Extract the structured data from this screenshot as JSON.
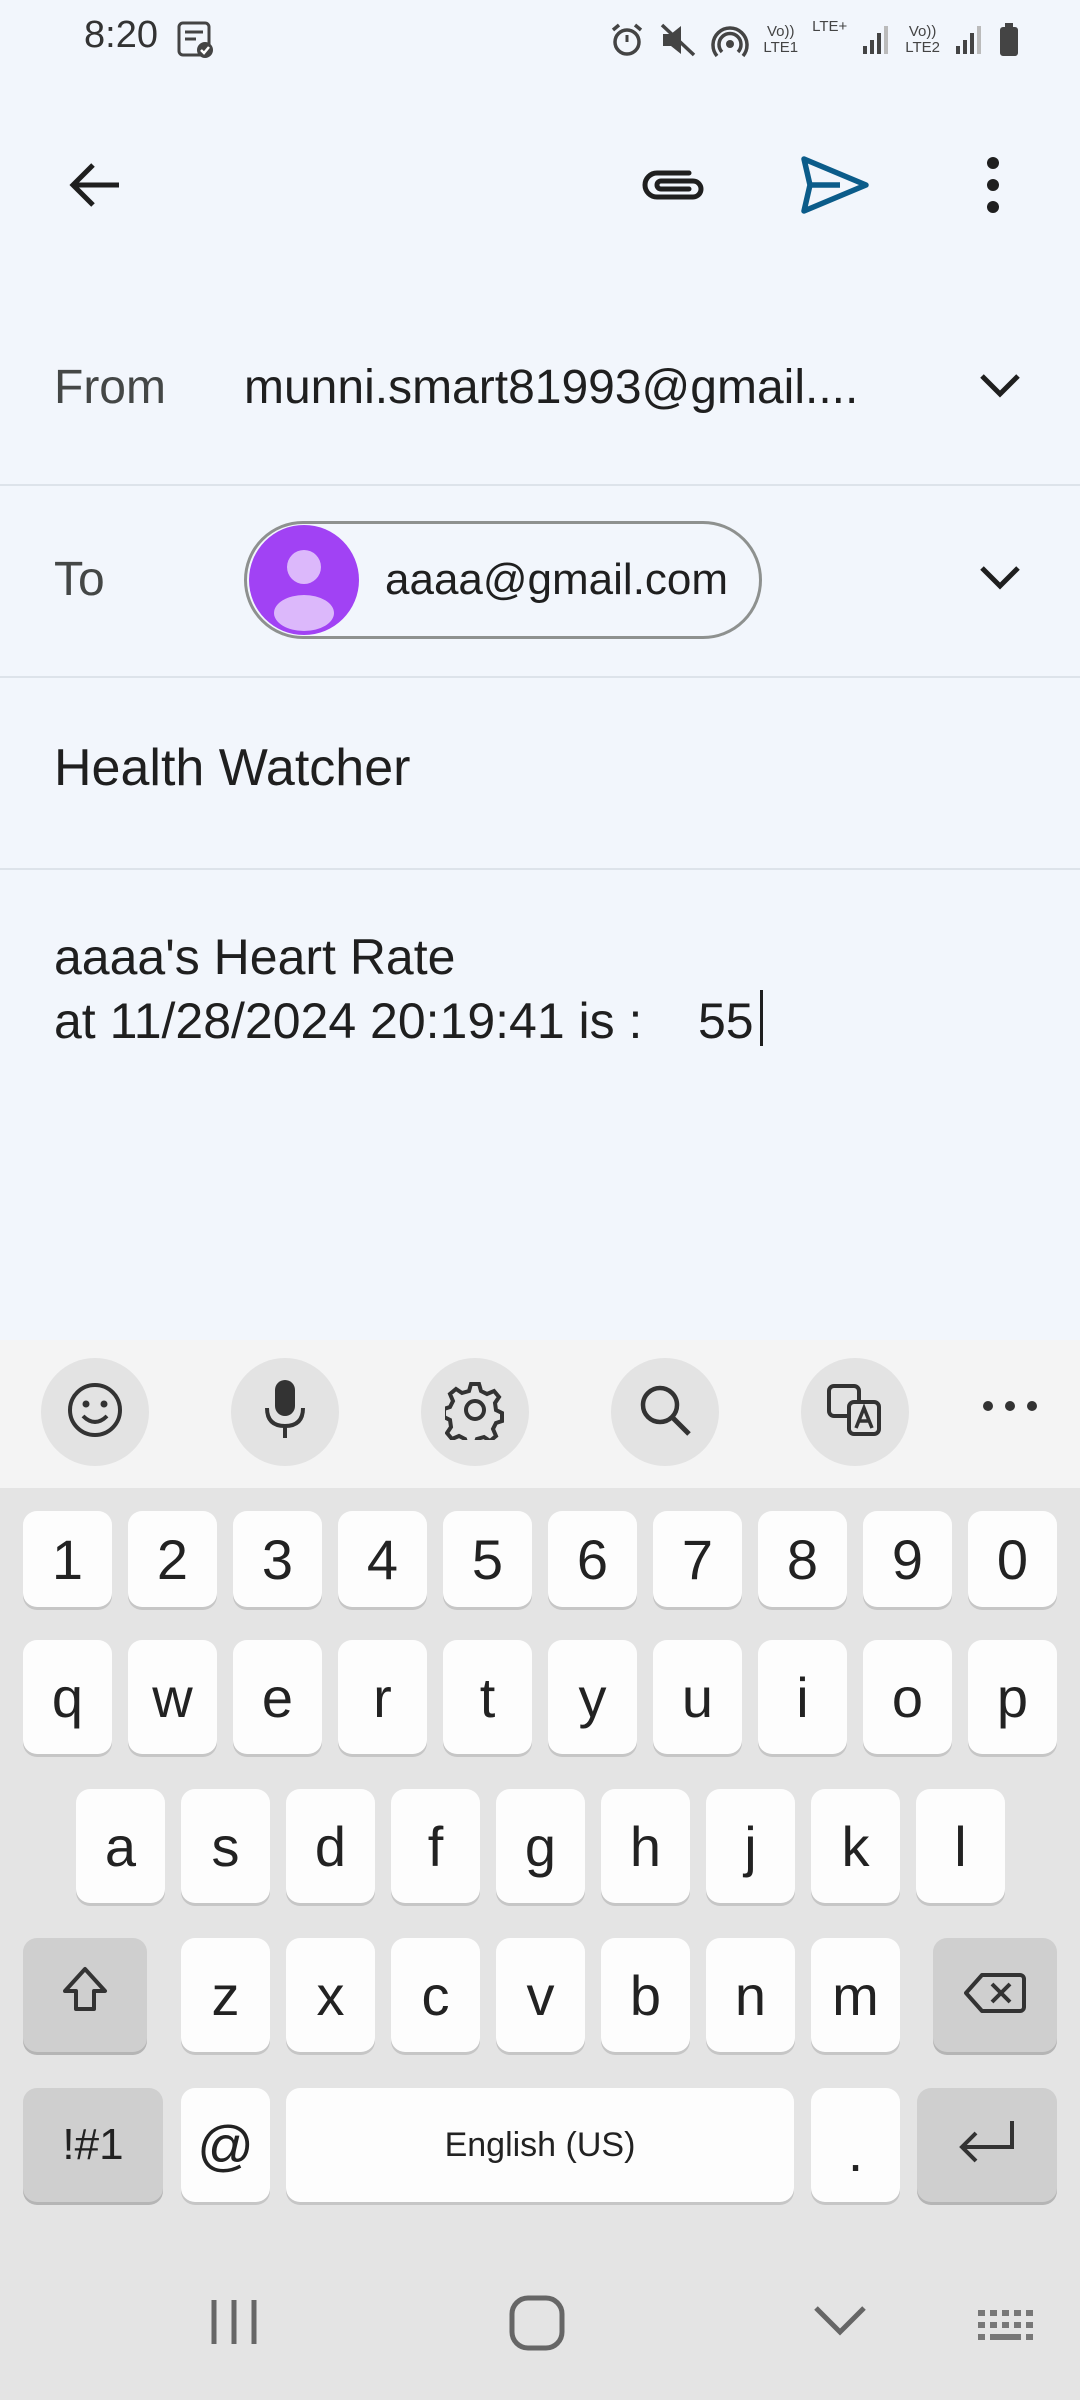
{
  "status_bar": {
    "time": "8:20",
    "icons": [
      "notification-icon",
      "alarm-icon",
      "mute-icon",
      "hotspot-icon",
      "volte-lte1-icon",
      "lte-plus-icon",
      "signal-1-icon",
      "volte-lte2-icon",
      "signal-2-icon",
      "battery-icon"
    ],
    "lte1_label": "Vo))\nLTE1",
    "lte_plus_label": "LTE+",
    "lte2_label": "Vo))\nLTE2"
  },
  "app_bar": {
    "icons": [
      "back-arrow-icon",
      "paperclip-icon",
      "send-icon",
      "more-vert-icon"
    ],
    "send_color": "#0b57d0"
  },
  "compose": {
    "from_label": "From",
    "from_value": "munni.smart81993@gmail....",
    "to_label": "To",
    "to_chip": "aaaa@gmail.com",
    "chip_avatar_color": "#a142f4",
    "subject": "Health Watcher",
    "body_line1": "aaaa's Heart Rate",
    "body_line2": "at 11/28/2024 20:19:41 is :    55"
  },
  "keyboard": {
    "toolbar_icons": [
      "emoji-icon",
      "microphone-icon",
      "settings-icon",
      "search-icon",
      "translate-icon",
      "more-horiz-icon"
    ],
    "number_row": [
      "1",
      "2",
      "3",
      "4",
      "5",
      "6",
      "7",
      "8",
      "9",
      "0"
    ],
    "row1": [
      "q",
      "w",
      "e",
      "r",
      "t",
      "y",
      "u",
      "i",
      "o",
      "p"
    ],
    "row2": [
      "a",
      "s",
      "d",
      "f",
      "g",
      "h",
      "j",
      "k",
      "l"
    ],
    "row3": [
      "z",
      "x",
      "c",
      "v",
      "b",
      "n",
      "m"
    ],
    "symbols_label": "!#1",
    "at_label": "@",
    "space_label": "English (US)",
    "period_label": "."
  },
  "nav_bar": {
    "icons": [
      "recents-icon",
      "home-icon",
      "back-chevron-icon",
      "keyboard-switch-icon"
    ]
  }
}
